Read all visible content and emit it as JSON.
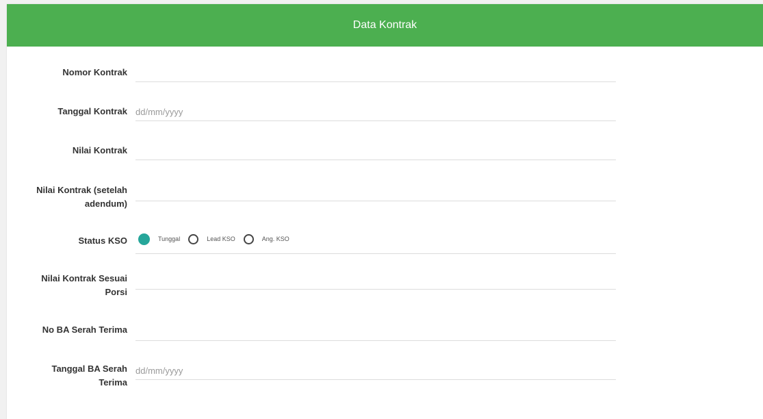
{
  "header": {
    "title": "Data Kontrak"
  },
  "form": {
    "nomor_kontrak": {
      "label": "Nomor Kontrak",
      "value": ""
    },
    "tanggal_kontrak": {
      "label": "Tanggal Kontrak",
      "placeholder": "dd/mm/yyyy",
      "value": ""
    },
    "nilai_kontrak": {
      "label": "Nilai Kontrak",
      "value": ""
    },
    "nilai_kontrak_adendum": {
      "label_line1": "Nilai Kontrak (setelah",
      "label_line2": "adendum)",
      "value": ""
    },
    "status_kso": {
      "label": "Status KSO",
      "options": [
        "Tunggal",
        "Lead KSO",
        "Ang. KSO"
      ],
      "selected": "Tunggal"
    },
    "nilai_kontrak_porsi": {
      "label_line1": "Nilai Kontrak Sesuai",
      "label_line2": "Porsi",
      "value": ""
    },
    "no_ba_serah_terima": {
      "label": "No BA Serah Terima",
      "value": ""
    },
    "tanggal_ba_serah_terima": {
      "label_line1": "Tanggal BA Serah",
      "label_line2": "Terima",
      "placeholder": "dd/mm/yyyy",
      "value": ""
    }
  },
  "colors": {
    "header": "#4caf50",
    "radio_selected": "#26a69a"
  }
}
